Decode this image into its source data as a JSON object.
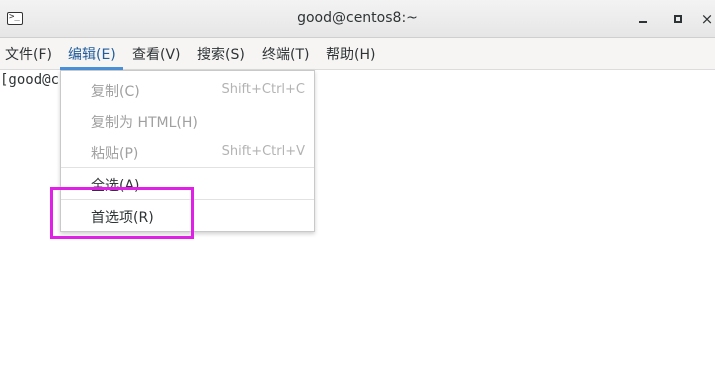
{
  "window": {
    "title": "good@centos8:~",
    "close_glyph": "×"
  },
  "menubar": {
    "items": [
      {
        "label": "文件(F)"
      },
      {
        "label": "编辑(E)"
      },
      {
        "label": "查看(V)"
      },
      {
        "label": "搜索(S)"
      },
      {
        "label": "终端(T)"
      },
      {
        "label": "帮助(H)"
      }
    ],
    "active_index": 1
  },
  "terminal": {
    "visible_text": "[good@c"
  },
  "dropdown": {
    "items": [
      {
        "label": "复制(C)",
        "accel": "Shift+Ctrl+C",
        "enabled": false
      },
      {
        "label": "复制为 HTML(H)",
        "accel": "",
        "enabled": false
      },
      {
        "label": "粘贴(P)",
        "accel": "Shift+Ctrl+V",
        "enabled": false
      },
      {
        "label": "全选(A)",
        "accel": "",
        "enabled": true
      },
      {
        "label": "首选项(R)",
        "accel": "",
        "enabled": true
      }
    ]
  },
  "annotation": {
    "highlight_color": "#e020e6",
    "highlighted_item": "首选项(R)"
  },
  "colors": {
    "menu_active": "#215d9c",
    "menu_underline": "#4a90d9"
  }
}
